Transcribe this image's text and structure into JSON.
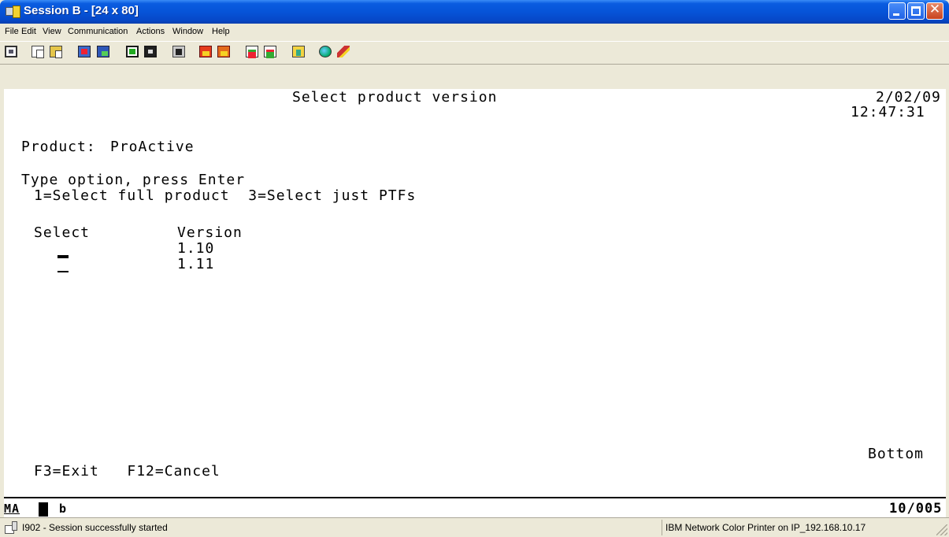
{
  "window": {
    "title": "Session B - [24 x 80]"
  },
  "menu": [
    "File",
    "Edit",
    "View",
    "Communication",
    "Actions",
    "Window",
    "Help"
  ],
  "toolbar_icons": [
    "print-screen-icon",
    "copy-icon",
    "paste-icon",
    "send-file-icon",
    "receive-file-icon",
    "display-keypad-icon",
    "display-color-icon",
    "macro-icon",
    "play-macro-icon",
    "record-macro-icon",
    "display-session-icon",
    "display-session-2-icon",
    "clipboard-icon",
    "globe-icon",
    "pencil-icon"
  ],
  "terminal": {
    "screen_title": "Select product version",
    "date": "2/02/09",
    "time": "12:47:31",
    "product_label": "Product:",
    "product_value": "ProActive",
    "instruction": "Type option, press Enter",
    "options": "1=Select full product  3=Select just PTFs",
    "col_select": "Select",
    "col_version": "Version",
    "versions": [
      "1.10",
      "1.11"
    ],
    "more_indicator": "Bottom",
    "function_keys": "F3=Exit   F12=Cancel"
  },
  "oia": {
    "mode": "MA",
    "indicator": "b",
    "cursor_position": "10/005"
  },
  "status": {
    "message": "I902 - Session successfully started",
    "printer": "IBM Network Color Printer on IP_192.168.10.17"
  }
}
